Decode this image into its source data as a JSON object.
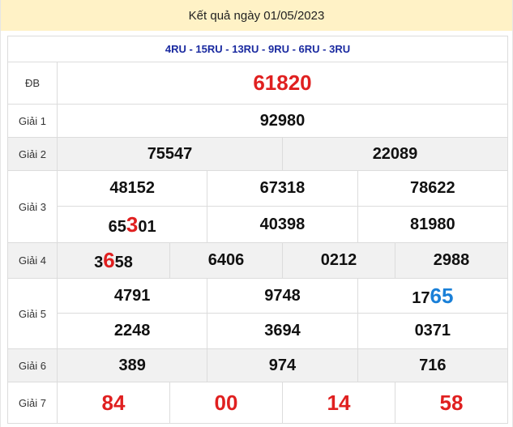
{
  "header": {
    "title": "Kết quả ngày 01/05/2023"
  },
  "codes": "4RU - 15RU - 13RU - 9RU - 6RU - 3RU",
  "labels": {
    "db": "ĐB",
    "g1": "Giải 1",
    "g2": "Giải 2",
    "g3": "Giải 3",
    "g4": "Giải 4",
    "g5": "Giải 5",
    "g6": "Giải 6",
    "g7": "Giải 7"
  },
  "prizes": {
    "db": "61820",
    "g1": "92980",
    "g2": [
      "75547",
      "22089"
    ],
    "g3": [
      {
        "prefix": "48152",
        "highlight": "",
        "suffix": ""
      },
      {
        "prefix": "67318",
        "highlight": "",
        "suffix": ""
      },
      {
        "prefix": "78622",
        "highlight": "",
        "suffix": ""
      },
      {
        "prefix": "65",
        "highlight": "3",
        "suffix": "01"
      },
      {
        "prefix": "40398",
        "highlight": "",
        "suffix": ""
      },
      {
        "prefix": "81980",
        "highlight": "",
        "suffix": ""
      }
    ],
    "g4": [
      {
        "prefix": "3",
        "highlight": "6",
        "suffix": "58"
      },
      {
        "prefix": "6406",
        "highlight": "",
        "suffix": ""
      },
      {
        "prefix": "0212",
        "highlight": "",
        "suffix": ""
      },
      {
        "prefix": "2988",
        "highlight": "",
        "suffix": ""
      }
    ],
    "g5": [
      {
        "prefix": "4791",
        "highlight": "",
        "suffix": ""
      },
      {
        "prefix": "9748",
        "highlight": "",
        "suffix": ""
      },
      {
        "prefix": "17",
        "highlight": "65",
        "suffix": ""
      },
      {
        "prefix": "2248",
        "highlight": "",
        "suffix": ""
      },
      {
        "prefix": "3694",
        "highlight": "",
        "suffix": ""
      },
      {
        "prefix": "0371",
        "highlight": "",
        "suffix": ""
      }
    ],
    "g6": [
      "389",
      "974",
      "716"
    ],
    "g7": [
      "84",
      "00",
      "14",
      "58"
    ]
  },
  "colors": {
    "header_bg": "#fff2c6",
    "code_text": "#1a2aa0",
    "red": "#e02020",
    "blue": "#1a80d8",
    "row_gray": "#f1f1f1"
  }
}
